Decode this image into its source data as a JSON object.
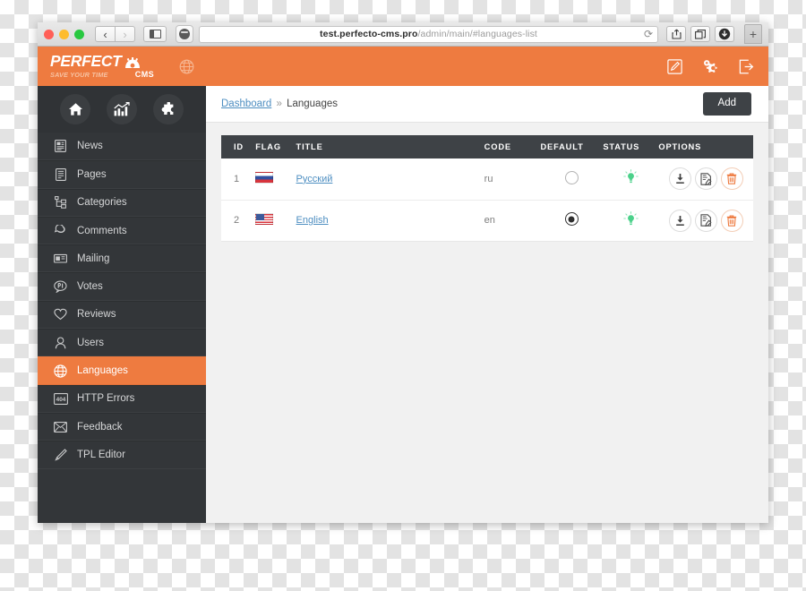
{
  "browser": {
    "nav_back": "‹",
    "nav_forward": "›",
    "sidebar_toggle_name": "sidebar-toggle",
    "url_host": "test.perfecto-cms.pro",
    "url_path": "/admin/main/#languages-list",
    "reload_glyph": "⟳",
    "new_tab_glyph": "+"
  },
  "header": {
    "logo_main": "PERFECT",
    "logo_tagline": "SAVE YOUR TIME",
    "logo_cms": "CMS",
    "globe_icon": "globe-icon",
    "actions": [
      {
        "name": "edit-site-button",
        "icon": "pencil-square-icon"
      },
      {
        "name": "settings-button",
        "icon": "gear-icon"
      },
      {
        "name": "logout-button",
        "icon": "logout-icon"
      }
    ]
  },
  "sidebar": {
    "quick_buttons": [
      {
        "name": "quick-home-button",
        "icon": "home-icon"
      },
      {
        "name": "quick-statistics-button",
        "icon": "bar-chart-icon"
      },
      {
        "name": "quick-modules-button",
        "icon": "puzzle-icon"
      }
    ],
    "items": [
      {
        "label": "News",
        "icon": "news-icon",
        "active": false
      },
      {
        "label": "Pages",
        "icon": "page-icon",
        "active": false
      },
      {
        "label": "Categories",
        "icon": "categories-icon",
        "active": false
      },
      {
        "label": "Comments",
        "icon": "comment-icon",
        "active": false
      },
      {
        "label": "Mailing",
        "icon": "mailing-icon",
        "active": false
      },
      {
        "label": "Votes",
        "icon": "vote-icon",
        "active": false
      },
      {
        "label": "Reviews",
        "icon": "heart-icon",
        "active": false
      },
      {
        "label": "Users",
        "icon": "user-icon",
        "active": false
      },
      {
        "label": "Languages",
        "icon": "globe-icon",
        "active": true
      },
      {
        "label": "HTTP Errors",
        "icon": "error-404-icon",
        "active": false
      },
      {
        "label": "Feedback",
        "icon": "envelope-icon",
        "active": false
      },
      {
        "label": "TPL Editor",
        "icon": "pen-icon",
        "active": false
      }
    ]
  },
  "main": {
    "breadcrumb": {
      "root": "Dashboard",
      "separator": "»",
      "current": "Languages"
    },
    "add_button": "Add",
    "table": {
      "columns": [
        "ID",
        "FLAG",
        "TITLE",
        "CODE",
        "DEFAULT",
        "STATUS",
        "OPTIONS"
      ],
      "rows": [
        {
          "id": "1",
          "flag": "flag-ru",
          "title": "Русский",
          "code": "ru",
          "is_default": false,
          "status": "active",
          "status_icon": "lightbulb-icon",
          "options": [
            {
              "name": "download-button",
              "icon": "download-icon"
            },
            {
              "name": "edit-button",
              "icon": "document-edit-icon"
            },
            {
              "name": "delete-button",
              "icon": "trash-icon"
            }
          ]
        },
        {
          "id": "2",
          "flag": "flag-us",
          "title": "English",
          "code": "en",
          "is_default": true,
          "status": "active",
          "status_icon": "lightbulb-icon",
          "options": [
            {
              "name": "download-button",
              "icon": "download-icon"
            },
            {
              "name": "edit-button",
              "icon": "document-edit-icon"
            },
            {
              "name": "delete-button",
              "icon": "trash-icon"
            }
          ]
        }
      ]
    }
  },
  "colors": {
    "brand_orange": "#ee7b40",
    "sidebar_dark": "#333639",
    "header_dark": "#3e4246",
    "link_blue": "#4d8ec1",
    "status_green": "#4bd18a"
  }
}
